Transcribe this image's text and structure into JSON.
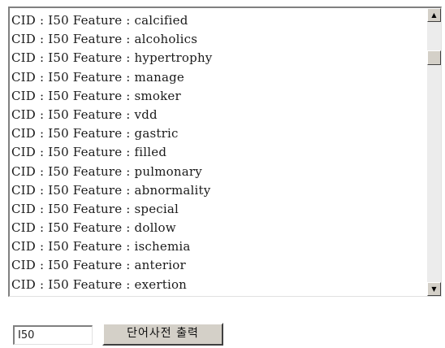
{
  "listbox": {
    "items": [
      "CID : I50 Feature : calcified",
      "CID : I50 Feature : alcoholics",
      "CID : I50 Feature : hypertrophy",
      "CID : I50 Feature : manage",
      "CID : I50 Feature : smoker",
      "CID : I50 Feature : vdd",
      "CID : I50 Feature : gastric",
      "CID : I50 Feature : filled",
      "CID : I50 Feature : pulmonary",
      "CID : I50 Feature : abnormality",
      "CID : I50 Feature : special",
      "CID : I50 Feature : dollow",
      "CID : I50 Feature : ischemia",
      "CID : I50 Feature : anterior",
      "CID : I50 Feature : exertion"
    ],
    "scroll_up_icon": "triangle-up",
    "scroll_down_icon": "triangle-down"
  },
  "controls": {
    "code_value": "I50",
    "button_label": "단어사전 출력"
  }
}
